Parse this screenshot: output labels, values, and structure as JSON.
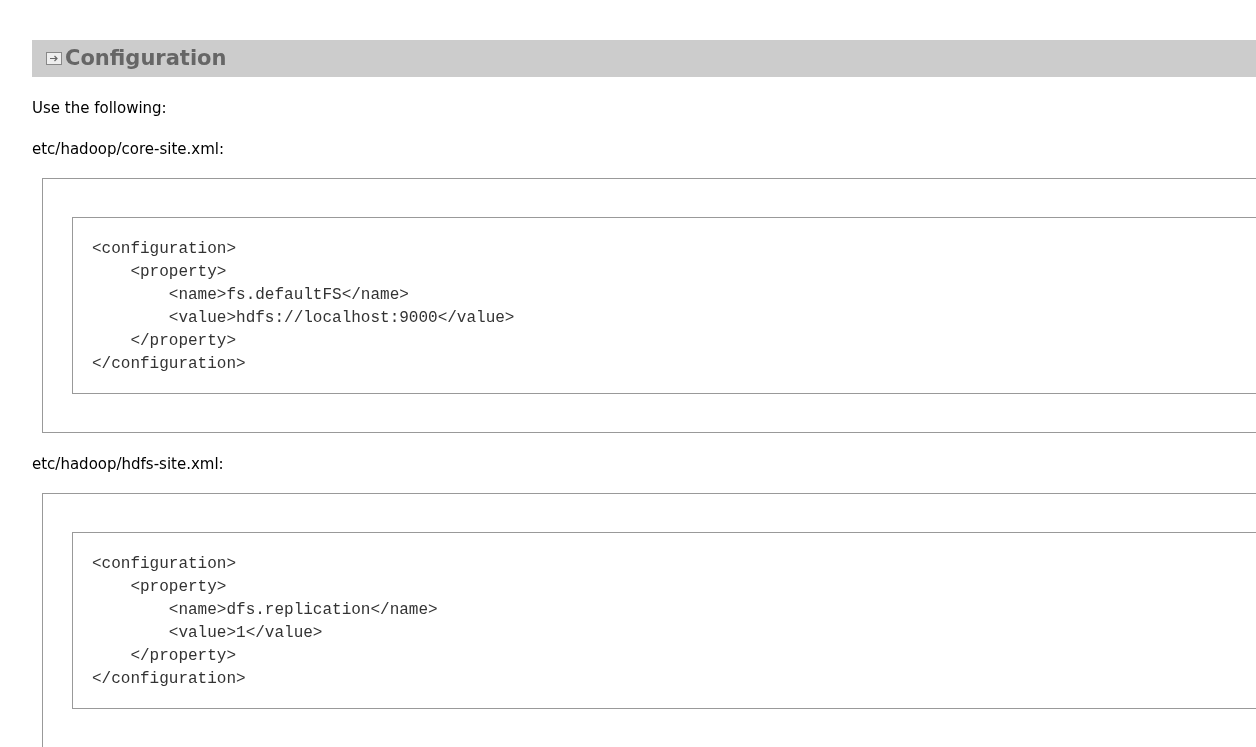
{
  "section": {
    "title": "Configuration"
  },
  "intro": "Use the following:",
  "files": [
    {
      "label": "etc/hadoop/core-site.xml:",
      "code": [
        "<configuration>",
        "    <property>",
        "        <name>fs.defaultFS</name>",
        "        <value>hdfs://localhost:9000</value>",
        "    </property>",
        "</configuration>"
      ]
    },
    {
      "label": "etc/hadoop/hdfs-site.xml:",
      "code": [
        "<configuration>",
        "    <property>",
        "        <name>dfs.replication</name>",
        "        <value>1</value>",
        "    </property>",
        "</configuration>"
      ]
    }
  ]
}
